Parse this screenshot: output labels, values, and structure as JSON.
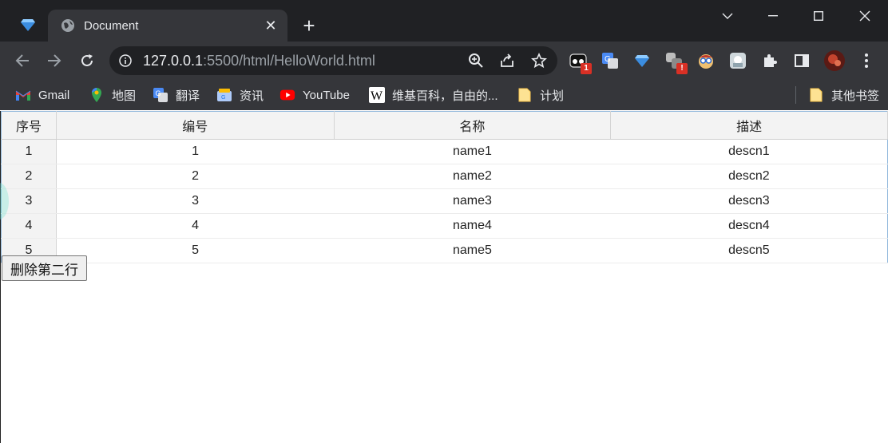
{
  "browser": {
    "tab_title": "Document",
    "url_host": "127.0.0.1",
    "url_rest": ":5500/html/HelloWorld.html",
    "extension_badge": "1",
    "extension_badge_2": "!"
  },
  "bookmarks": [
    {
      "label": "Gmail",
      "icon": "gmail-icon"
    },
    {
      "label": "地图",
      "icon": "maps-icon"
    },
    {
      "label": "翻译",
      "icon": "translate-icon"
    },
    {
      "label": "资讯",
      "icon": "news-icon"
    },
    {
      "label": "YouTube",
      "icon": "youtube-icon"
    },
    {
      "label": "维基百科，自由的...",
      "icon": "wikipedia-icon"
    },
    {
      "label": "计划",
      "icon": "folder-icon"
    }
  ],
  "other_bookmarks": "其他书签",
  "table": {
    "headers": [
      "序号",
      "编号",
      "名称",
      "描述"
    ],
    "rows": [
      [
        "1",
        "1",
        "name1",
        "descn1"
      ],
      [
        "2",
        "2",
        "name2",
        "descn2"
      ],
      [
        "3",
        "3",
        "name3",
        "descn3"
      ],
      [
        "4",
        "4",
        "name4",
        "descn4"
      ],
      [
        "5",
        "5",
        "name5",
        "descn5"
      ]
    ]
  },
  "delete_button_label": "删除第二行",
  "colors": {
    "chrome_dark": "#202124",
    "chrome_mid": "#35363a",
    "table_border": "#8fb7dc",
    "header_bg": "#f3f3f3"
  }
}
